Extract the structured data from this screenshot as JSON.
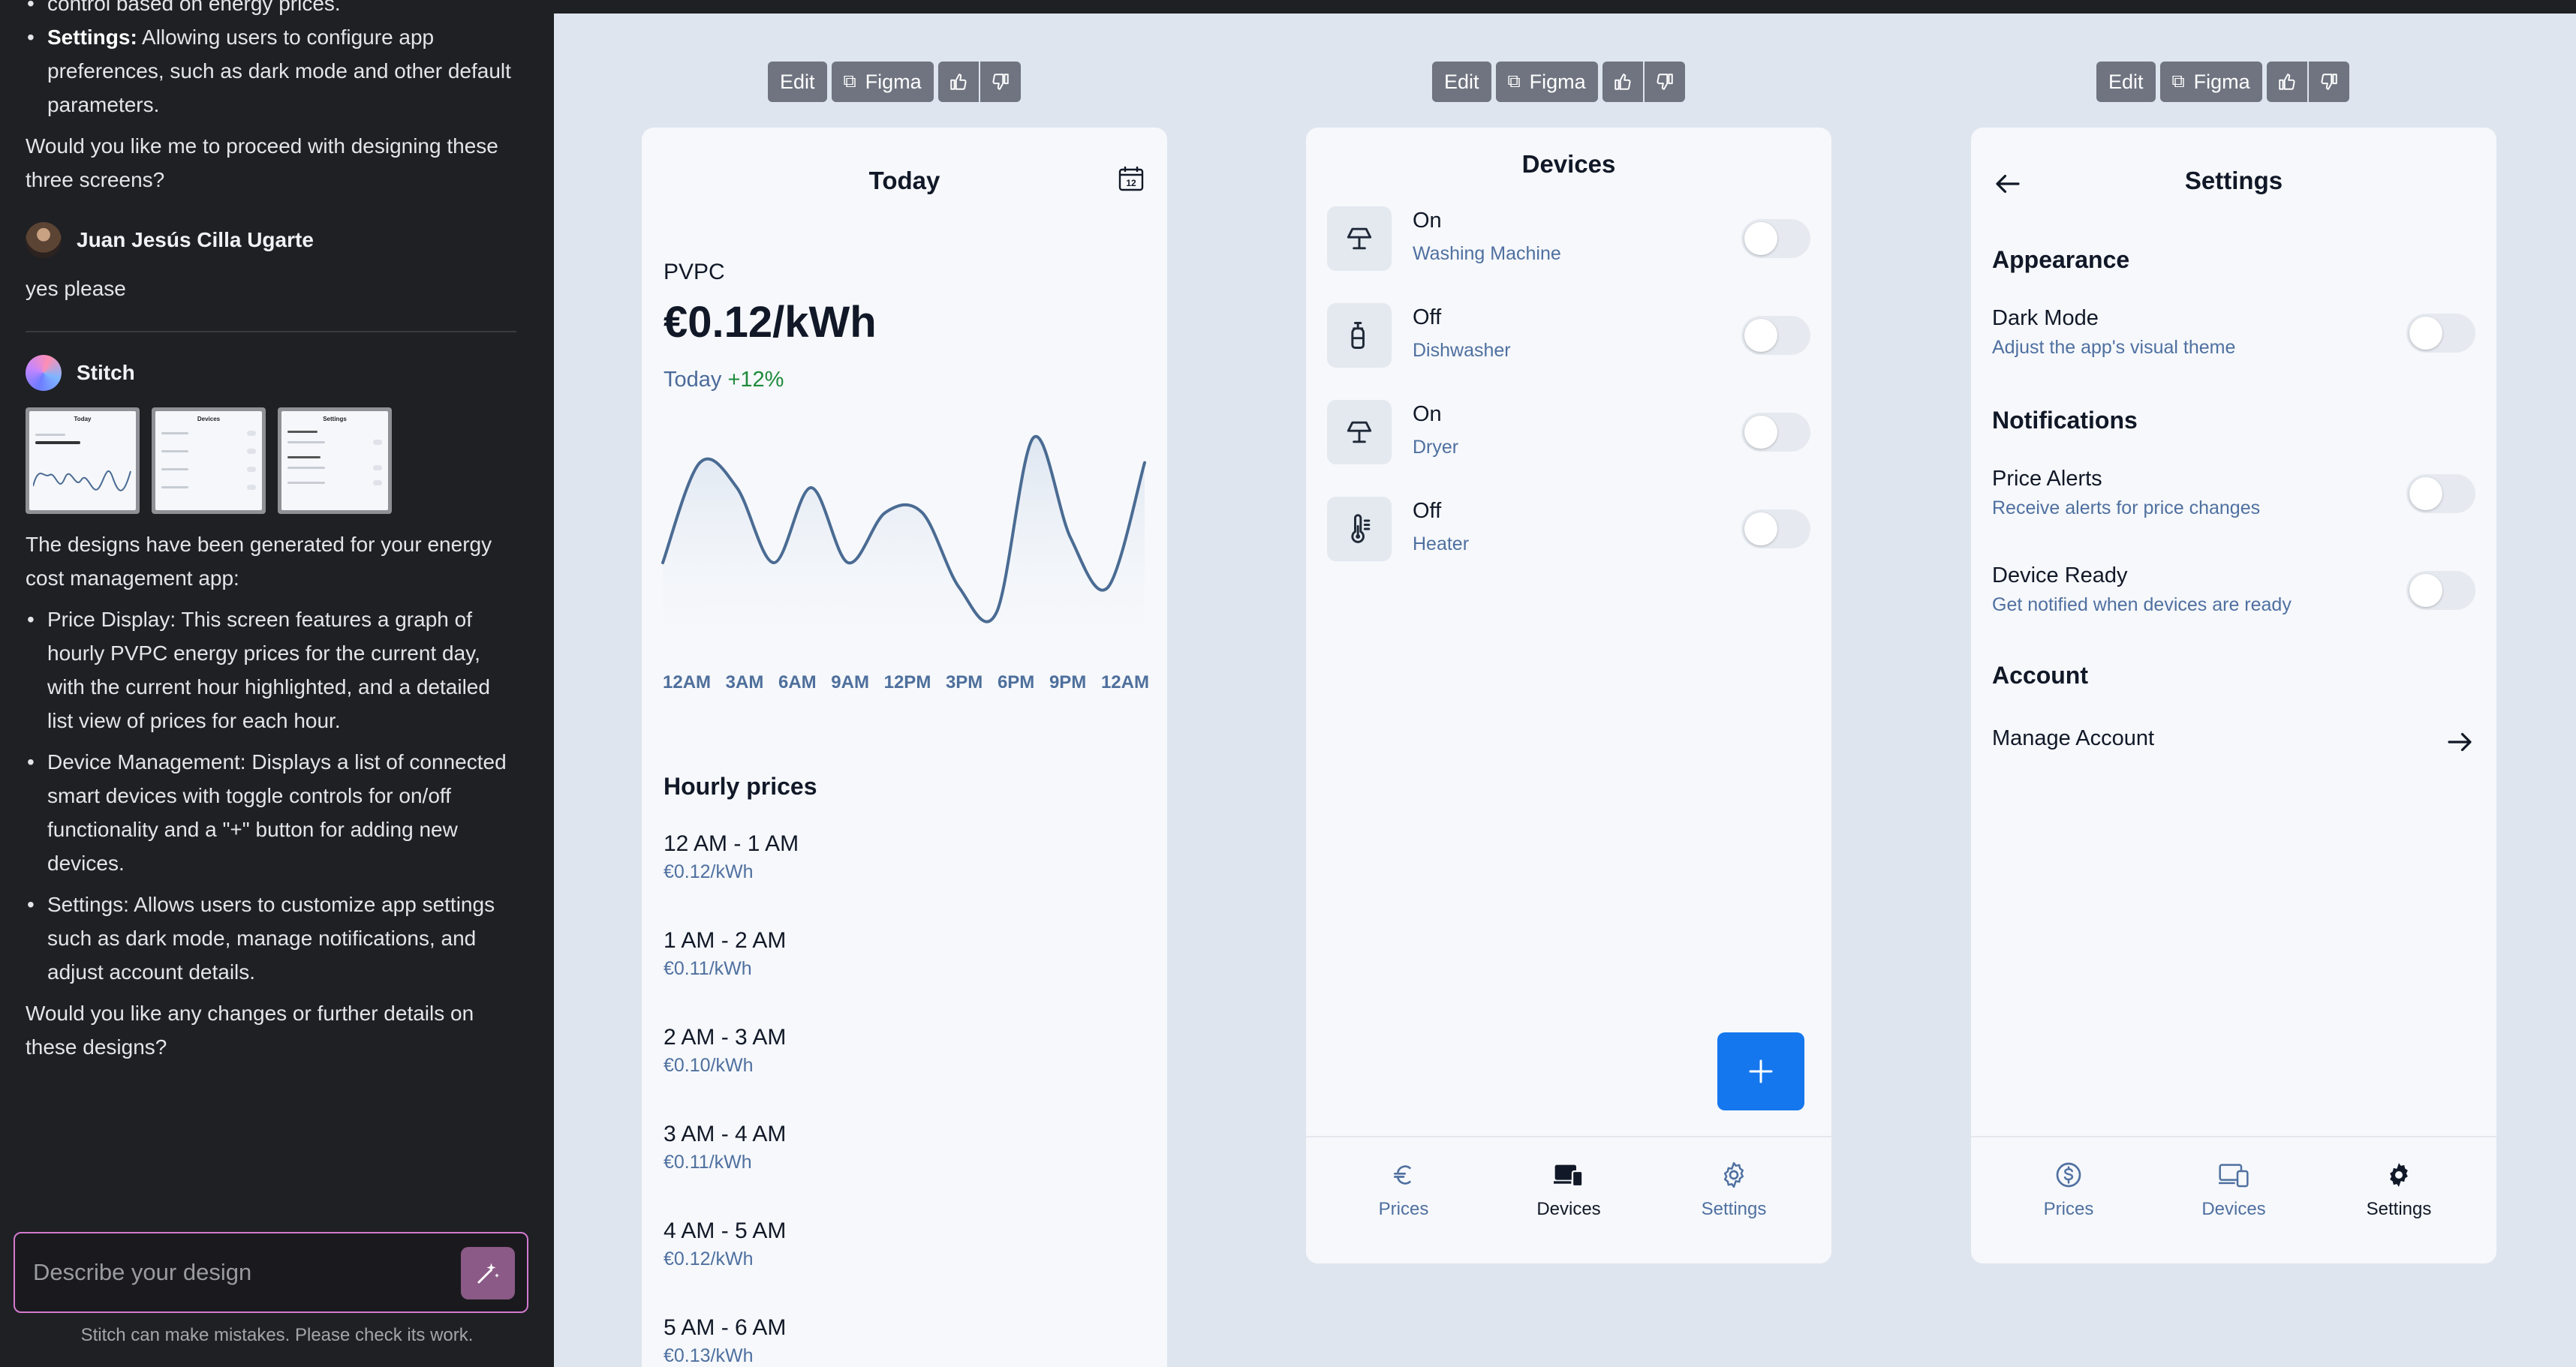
{
  "chat": {
    "top_fragment": "control based on energy prices.",
    "settings_bullet_bold": "Settings:",
    "settings_bullet_text": "Allowing users to configure app preferences, such as dark mode and other default parameters.",
    "question1": "Would you like me to proceed with designing these three screens?",
    "user_name": "Juan Jesús Cilla Ugarte",
    "user_message": "yes please",
    "assistant_name": "Stitch",
    "thumbnails": [
      {
        "title": "Today"
      },
      {
        "title": "Devices"
      },
      {
        "title": "Settings"
      }
    ],
    "summary_intro": "The designs have been generated for your energy cost management app:",
    "bullets": [
      "Price Display: This screen features a graph of hourly PVPC energy prices for the current day, with the current hour highlighted, and a detailed list view of prices for each hour.",
      "Device Management: Displays a list of connected smart devices with toggle controls for on/off functionality and a \"+\" button for adding new devices.",
      "Settings: Allows users to customize app settings such as dark mode, manage notifications, and adjust account details."
    ],
    "question2": "Would you like any changes or further details on these designs?",
    "composer_placeholder": "Describe your design",
    "disclaimer": "Stitch can make mistakes. Please check its work."
  },
  "toolbar": {
    "edit_label": "Edit",
    "figma_label": "Figma"
  },
  "prices_screen": {
    "title": "Today",
    "calendar_day": "12",
    "tariff": "PVPC",
    "current_price": "€0.12/kWh",
    "today_label": "Today",
    "today_change": "+12%",
    "hourly_title": "Hourly prices",
    "hours": [
      {
        "range": "12 AM - 1 AM",
        "price": "€0.12/kWh"
      },
      {
        "range": "1 AM - 2 AM",
        "price": "€0.11/kWh"
      },
      {
        "range": "2 AM - 3 AM",
        "price": "€0.10/kWh"
      },
      {
        "range": "3 AM - 4 AM",
        "price": "€0.11/kWh"
      },
      {
        "range": "4 AM - 5 AM",
        "price": "€0.12/kWh"
      },
      {
        "range": "5 AM - 6 AM",
        "price": "€0.13/kWh"
      }
    ]
  },
  "chart_data": {
    "type": "line",
    "title": "",
    "xlabel": "",
    "ylabel": "",
    "x": [
      "12AM",
      "3AM",
      "6AM",
      "9AM",
      "12PM",
      "3PM",
      "6PM",
      "9PM",
      "12AM"
    ],
    "tick_labels": [
      "12AM",
      "3AM",
      "6AM",
      "9AM",
      "12PM",
      "3PM",
      "6PM",
      "9PM",
      "12AM"
    ],
    "y_axis_visible": false,
    "grid": false,
    "series": [
      {
        "values": [
          0.11,
          0.15,
          0.14,
          0.11,
          0.14,
          0.11,
          0.13,
          0.13,
          0.1,
          0.09,
          0.16,
          0.12,
          0.1,
          0.15
        ]
      }
    ],
    "ylim": [
      0.08,
      0.17
    ],
    "line_color": "#4a6b93"
  },
  "devices_screen": {
    "title": "Devices",
    "devices": [
      {
        "state": "On",
        "name": "Washing Machine",
        "icon": "lamp-icon"
      },
      {
        "state": "Off",
        "name": "Dishwasher",
        "icon": "soap-bottle-icon"
      },
      {
        "state": "On",
        "name": "Dryer",
        "icon": "lamp-icon"
      },
      {
        "state": "Off",
        "name": "Heater",
        "icon": "thermometer-icon"
      }
    ],
    "fab_label": "+"
  },
  "settings_screen": {
    "title": "Settings",
    "appearance_title": "Appearance",
    "dark_mode_title": "Dark Mode",
    "dark_mode_desc": "Adjust the app's visual theme",
    "notifications_title": "Notifications",
    "price_alerts_title": "Price Alerts",
    "price_alerts_desc": "Receive alerts for price changes",
    "device_ready_title": "Device Ready",
    "device_ready_desc": "Get notified when devices are ready",
    "account_title": "Account",
    "manage_account": "Manage Account"
  },
  "tabs": {
    "prices": "Prices",
    "devices": "Devices",
    "settings": "Settings"
  },
  "colors": {
    "accent": "#1577ee",
    "positive": "#1f8a3b",
    "muted_blue": "#4f70a0",
    "sidebar_bg": "#1f2024",
    "canvas_bg": "#dfe5ee"
  }
}
